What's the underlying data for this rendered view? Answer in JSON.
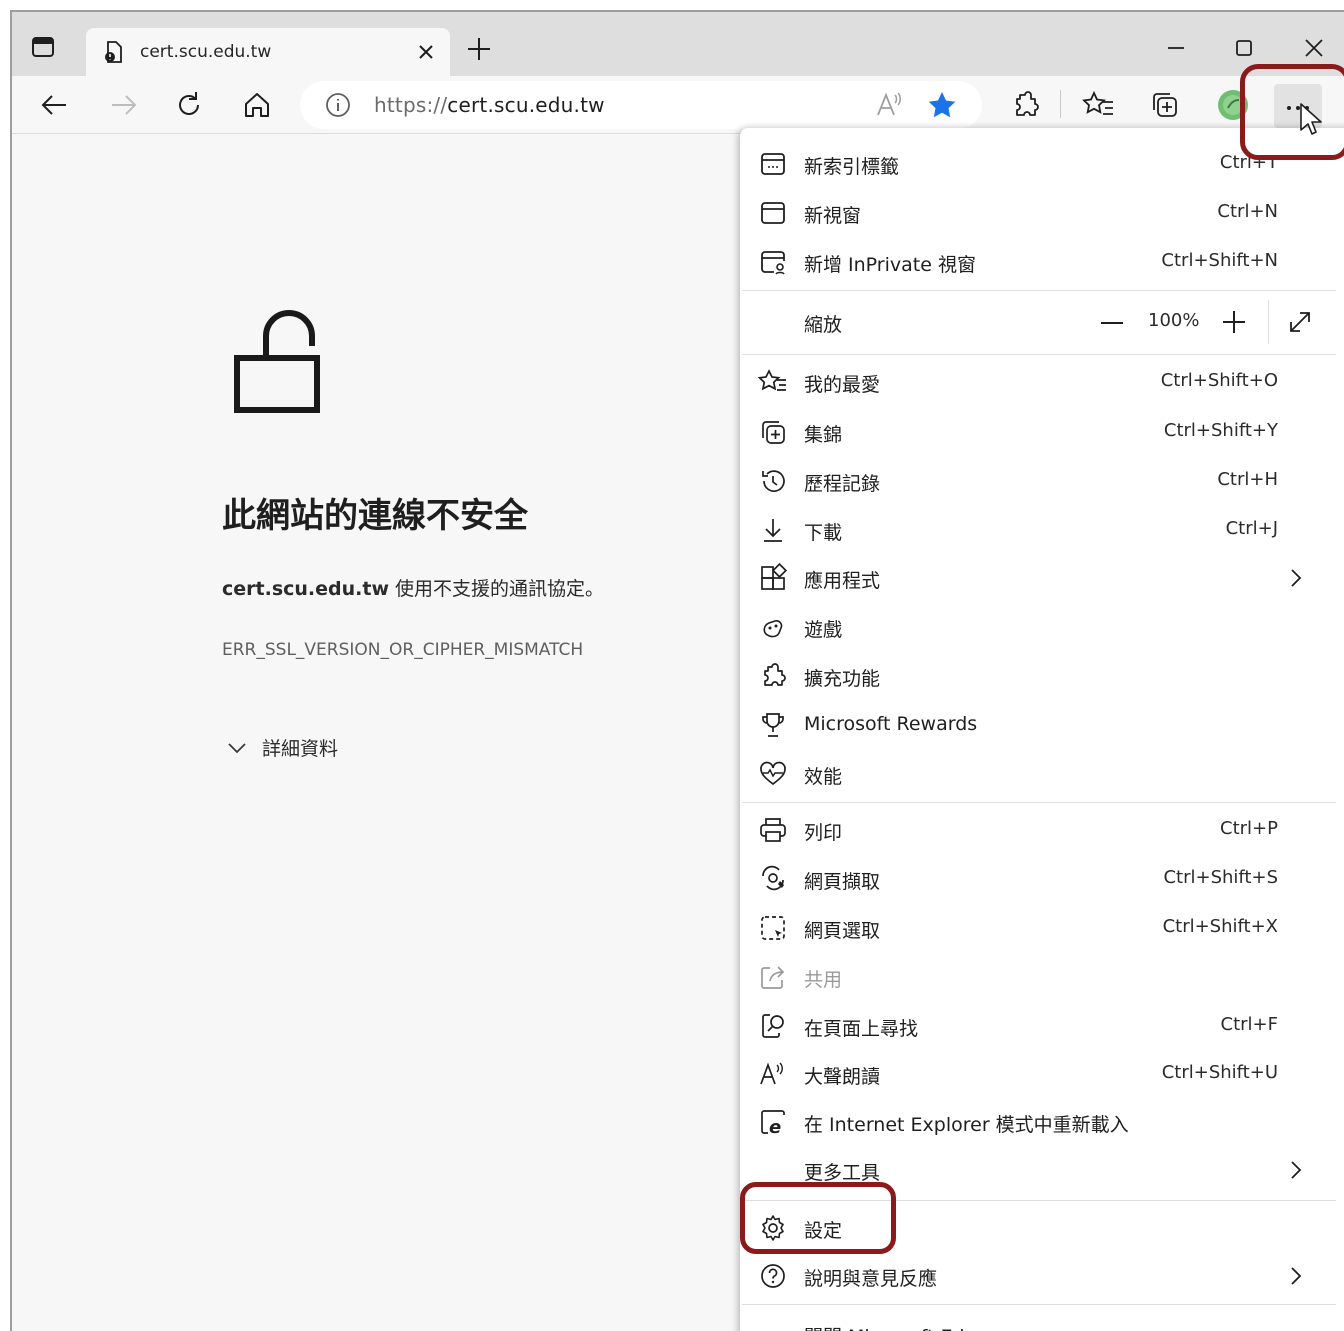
{
  "tab": {
    "title": "cert.scu.edu.tw"
  },
  "address": {
    "scheme": "https://",
    "host": "cert.scu.edu.tw"
  },
  "error": {
    "title": "此網站的連線不安全",
    "host": "cert.scu.edu.tw",
    "message": " 使用不支援的通訊協定。",
    "code": "ERR_SSL_VERSION_OR_CIPHER_MISMATCH",
    "details_label": "詳細資料"
  },
  "menu": {
    "new_tab": {
      "label": "新索引標籤",
      "shortcut": "Ctrl+T"
    },
    "new_window": {
      "label": "新視窗",
      "shortcut": "Ctrl+N"
    },
    "new_inprivate": {
      "label": "新增 InPrivate 視窗",
      "shortcut": "Ctrl+Shift+N"
    },
    "zoom": {
      "label": "縮放",
      "value": "100%"
    },
    "favorites": {
      "label": "我的最愛",
      "shortcut": "Ctrl+Shift+O"
    },
    "collections": {
      "label": "集錦",
      "shortcut": "Ctrl+Shift+Y"
    },
    "history": {
      "label": "歷程記錄",
      "shortcut": "Ctrl+H"
    },
    "downloads": {
      "label": "下載",
      "shortcut": "Ctrl+J"
    },
    "apps": {
      "label": "應用程式"
    },
    "games": {
      "label": "遊戲"
    },
    "extensions": {
      "label": "擴充功能"
    },
    "rewards": {
      "label": "Microsoft Rewards"
    },
    "performance": {
      "label": "效能"
    },
    "print": {
      "label": "列印",
      "shortcut": "Ctrl+P"
    },
    "web_capture": {
      "label": "網頁擷取",
      "shortcut": "Ctrl+Shift+S"
    },
    "web_select": {
      "label": "網頁選取",
      "shortcut": "Ctrl+Shift+X"
    },
    "share": {
      "label": "共用"
    },
    "find": {
      "label": "在頁面上尋找",
      "shortcut": "Ctrl+F"
    },
    "read_aloud": {
      "label": "大聲朗讀",
      "shortcut": "Ctrl+Shift+U"
    },
    "ie_mode": {
      "label": "在 Internet Explorer 模式中重新載入"
    },
    "more_tools": {
      "label": "更多工具"
    },
    "settings": {
      "label": "設定"
    },
    "help": {
      "label": "說明與意見反應"
    },
    "close": {
      "label": "關閉 Microsoft Edge"
    }
  },
  "colors": {
    "highlight": "#8b1a1a",
    "star": "#1a73e8"
  }
}
